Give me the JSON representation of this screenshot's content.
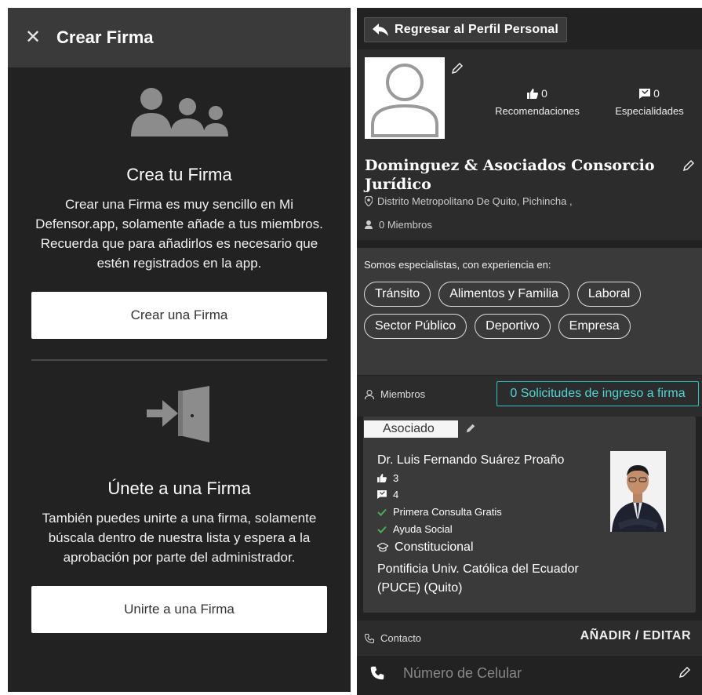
{
  "left_panel": {
    "header": {
      "close_icon": "close-icon",
      "title": "Crear Firma"
    },
    "create": {
      "icon": "group-icon",
      "title": "Crea tu Firma",
      "description": "Crear una Firma es muy sencillo en Mi Defensor.app, solamente añade a tus miembros. Recuerda que para añadirlos es necesario que estén registrados en la app.",
      "button_label": "Crear una Firma"
    },
    "join": {
      "icon": "door-enter-icon",
      "title": "Únete a una Firma",
      "description": "También puedes unirte a una firma, solamente búscala dentro de nuestra lista y espera a la aprobación por parte del administrador.",
      "button_label": "Unirte a una Firma"
    }
  },
  "right_panel": {
    "back_button_label": "Regresar al Perfil Personal",
    "profile": {
      "recommendations": {
        "count": "0",
        "label": "Recomendaciones"
      },
      "specialties": {
        "count": "0",
        "label": "Especialidades"
      },
      "firm_name": "Dominguez & Asociados Consorcio Jurídico",
      "location": "Distrito Metropolitano De Quito, Pichincha ,",
      "members": "0 Miembros"
    },
    "specialties": {
      "intro": "Somos especialistas, con experiencia en:",
      "chips": [
        "Tránsito",
        "Alimentos y Familia",
        "Laboral",
        "Sector Público",
        "Deportivo",
        "Empresa"
      ]
    },
    "members_section": {
      "label": "Miembros",
      "requests_button": "0 Solicitudes de ingreso a firma"
    },
    "member_card": {
      "role": "Asociado",
      "name": "Dr. Luis Fernando Suárez Proaño",
      "likes": "3",
      "comments": "4",
      "features": [
        "Primera Consulta Gratis",
        "Ayuda Social"
      ],
      "specialty": "Constitucional",
      "university": "Pontificia Univ. Católica del Ecuador (PUCE) (Quito)"
    },
    "contact": {
      "label": "Contacto",
      "edit_label": "AÑADIR / EDITAR",
      "phone_placeholder": "Número de Celular"
    },
    "colors": {
      "accent": "#2ec4c4",
      "check": "#4caf50",
      "panel_bg": "#222222"
    }
  }
}
